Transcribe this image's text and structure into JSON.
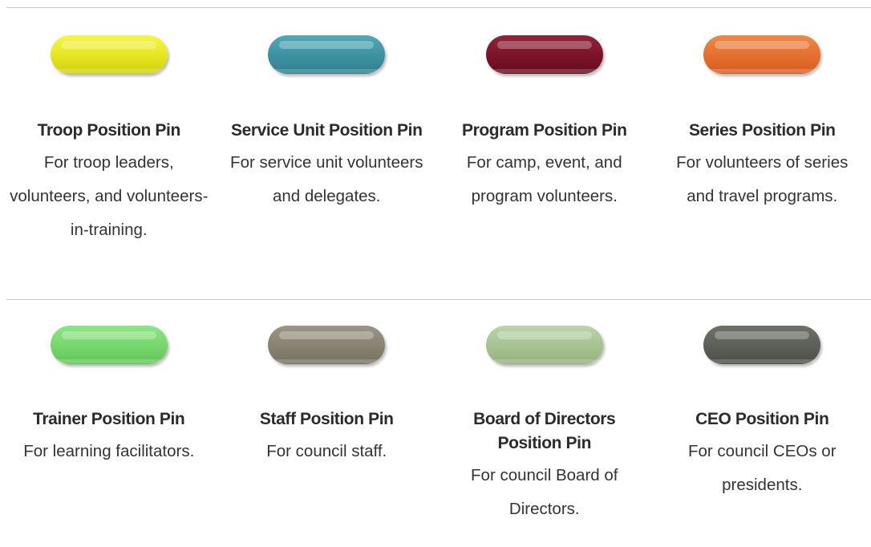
{
  "colors": {
    "troop": "#eded2a",
    "service_unit": "#3f96a6",
    "program": "#7c1428",
    "series": "#e87130",
    "trainer": "#78d96e",
    "staff": "#8a8575",
    "board": "#a7c494",
    "ceo": "#5d5f59"
  },
  "row1": [
    {
      "title": "Troop Position Pin",
      "desc": "For troop leaders, volunteers, and volunteers-in-training."
    },
    {
      "title": "Service Unit Position Pin",
      "desc": "For service unit volunteers and delegates."
    },
    {
      "title": "Program Position Pin",
      "desc": "For camp, event, and program volunteers."
    },
    {
      "title": "Series Position Pin",
      "desc": "For volunteers of series and travel programs."
    }
  ],
  "row2": [
    {
      "title": "Trainer Position Pin",
      "desc": "For learning facilitators."
    },
    {
      "title": "Staff Position Pin",
      "desc": "For council staff."
    },
    {
      "title": "Board of Directors Position Pin",
      "desc": "For council Board of Directors."
    },
    {
      "title": "CEO Position Pin",
      "desc": "For council CEOs or presidents."
    }
  ]
}
